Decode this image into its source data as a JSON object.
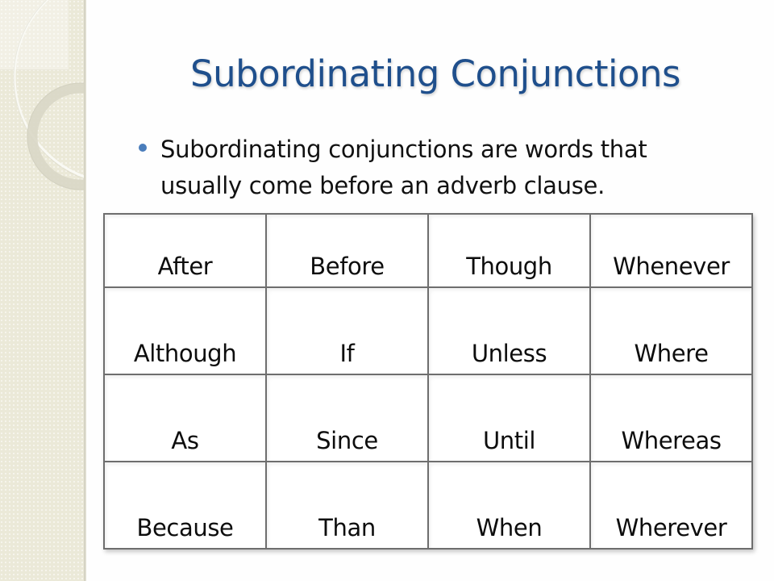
{
  "slide": {
    "title": "Subordinating Conjunctions",
    "bullets": [
      {
        "icon": "bullet-dot-icon",
        "text": "Subordinating conjunctions are words that usually come before an adverb clause."
      }
    ],
    "table": {
      "rows": [
        [
          "After",
          "Before",
          "Though",
          "Whenever"
        ],
        [
          "Although",
          "If",
          "Unless",
          "Where"
        ],
        [
          "As",
          "Since",
          "Until",
          "Whereas"
        ],
        [
          "Because",
          "Than",
          "When",
          "Wherever"
        ]
      ]
    },
    "colors": {
      "title": "#1f4f8c",
      "bullet": "#4a7dbb",
      "side_panel": "#ebe9d8",
      "table_border": "#6e6e6e",
      "text": "#111111"
    }
  }
}
